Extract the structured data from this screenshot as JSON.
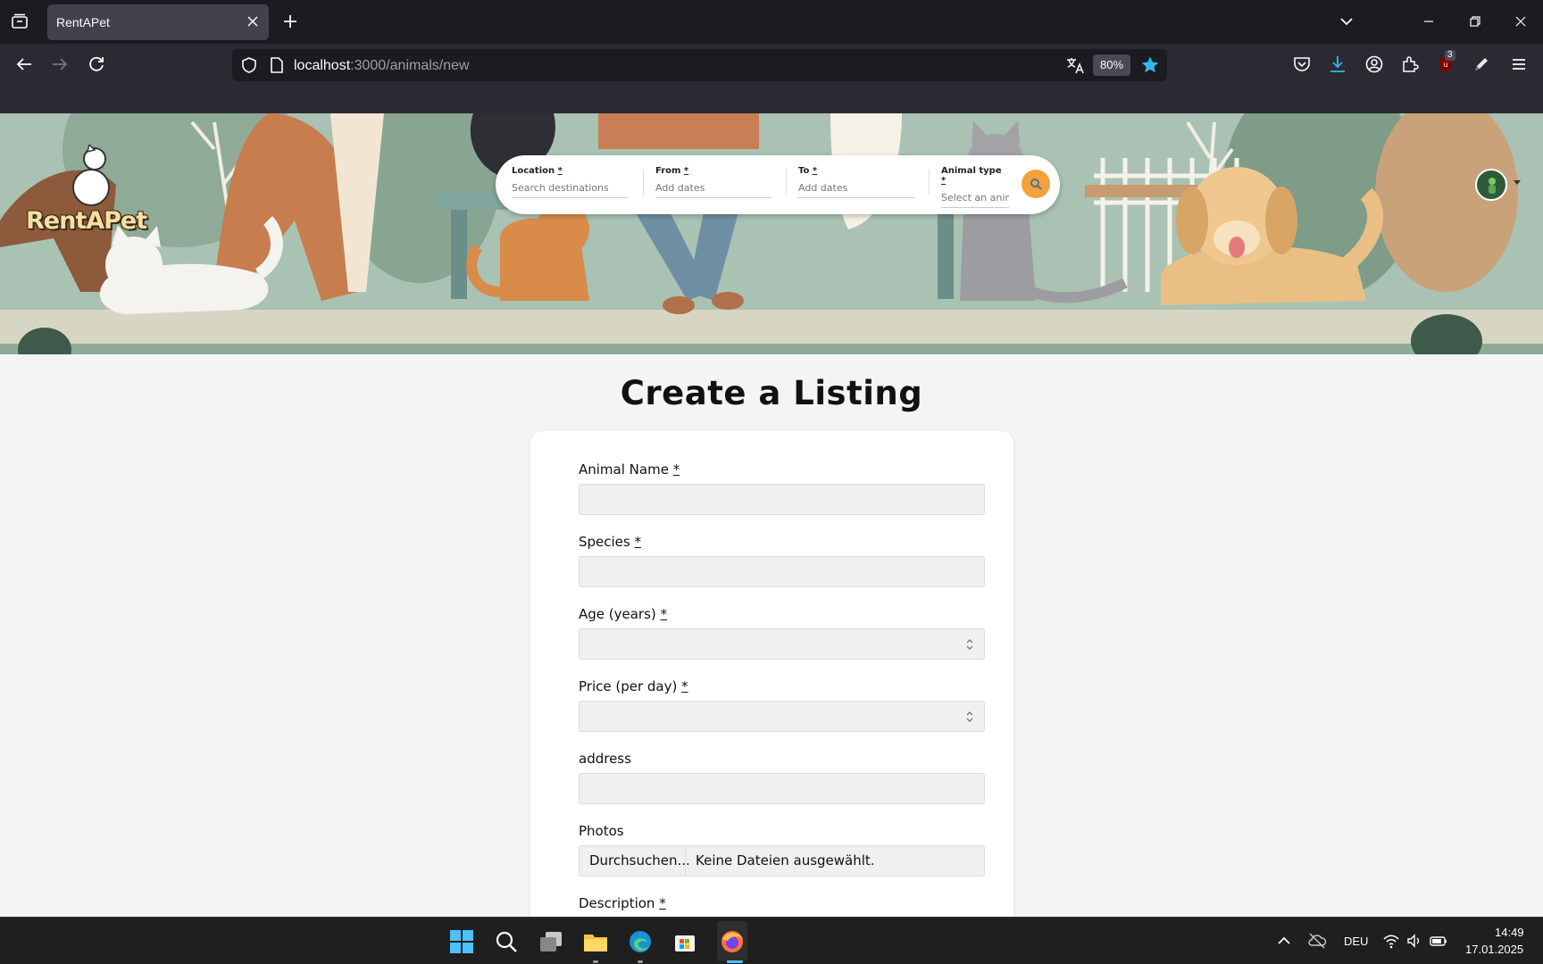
{
  "browser": {
    "tab_title": "RentAPet",
    "url_host": "localhost",
    "url_path": ":3000/animals/new",
    "zoom": "80%",
    "extension_badge": "3"
  },
  "header": {
    "logo": "RentAPet",
    "search": {
      "location_label": "Location",
      "location_placeholder": "Search destinations",
      "from_label": "From",
      "from_placeholder": "Add dates",
      "to_label": "To",
      "to_placeholder": "Add dates",
      "animal_type_label": "Animal type",
      "animal_type_placeholder": "Select an anima"
    },
    "required_mark": "*"
  },
  "main": {
    "title": "Create a Listing",
    "fields": {
      "animal_name": "Animal Name",
      "species": "Species",
      "age": "Age (years)",
      "price": "Price (per day)",
      "address": "address",
      "photos": "Photos",
      "description": "Description"
    },
    "file_button": "Durchsuchen...",
    "file_status": "Keine Dateien ausgewählt."
  },
  "taskbar": {
    "language": "DEU",
    "time": "14:49",
    "date": "17.01.2025"
  },
  "colors": {
    "accent": "#f5a03a",
    "chrome_bg": "#1c1b22",
    "toolbar_bg": "#2b2a33",
    "page_bg": "#f4f4f4"
  }
}
